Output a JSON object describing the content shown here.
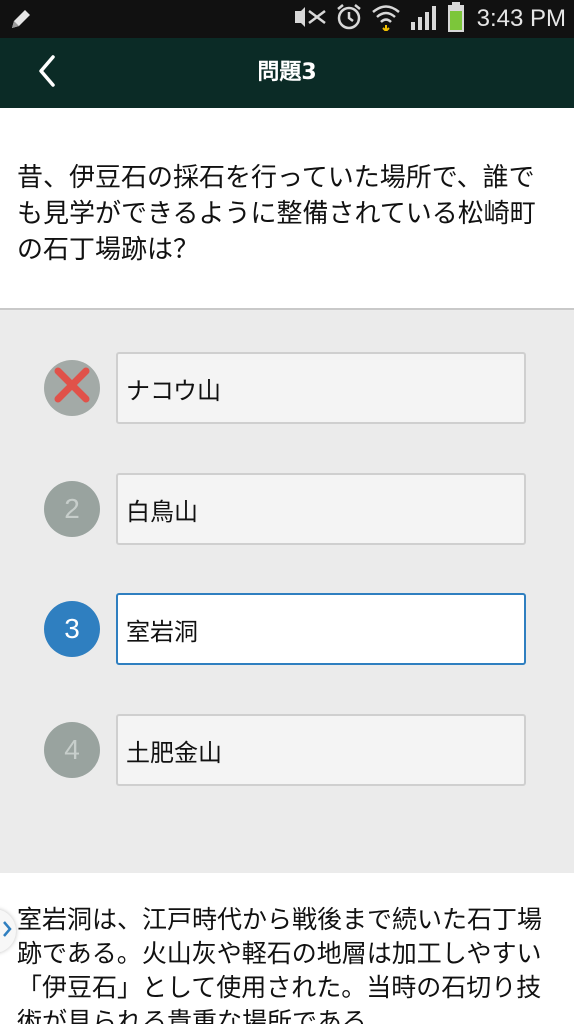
{
  "status_bar": {
    "time": "3:43 PM",
    "icons": [
      "edit-icon",
      "mute-icon",
      "alarm-icon",
      "wifi-icon",
      "signal-icon",
      "battery-icon"
    ]
  },
  "app_bar": {
    "title": "問題3",
    "back_icon": "chevron-left-icon"
  },
  "question": {
    "text": "昔、伊豆石の採石を行っていた場所で、誰でも見学ができるように整備されている松崎町の石丁場跡は？"
  },
  "answers": [
    {
      "marker": "",
      "label": "ナコウ山",
      "state": "wrong"
    },
    {
      "marker": "2",
      "label": "白鳥山",
      "state": "default"
    },
    {
      "marker": "3",
      "label": "室岩洞",
      "state": "selected"
    },
    {
      "marker": "4",
      "label": "土肥金山",
      "state": "default"
    }
  ],
  "explanation": {
    "text": "室岩洞は、江戸時代から戦後まで続いた石丁場跡である。火山灰や軽石の地層は加工しやすい「伊豆石」として使用された。当時の石切り技術が見られる貴重な場所である。"
  },
  "colors": {
    "app_bar": "#0b2b26",
    "selected": "#2f7fc0",
    "wrong_mark": "#e0524a",
    "marker_default": "#99a39f"
  }
}
